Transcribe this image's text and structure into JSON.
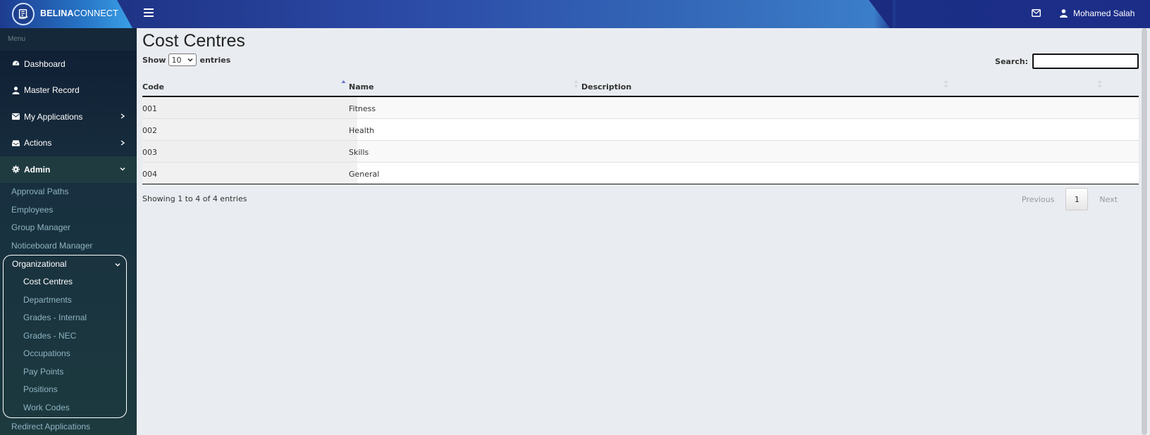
{
  "header": {
    "brand_bold": "BELINA",
    "brand_light": "CONNECT",
    "user_name": "Mohamed Salah",
    "icons": {
      "menu": "hamburger-icon",
      "mail": "envelope-icon",
      "user": "user-icon",
      "logo": "belina-logo-icon"
    }
  },
  "sidebar": {
    "menu_label": "Menu",
    "items": [
      {
        "label": "Dashboard",
        "icon": "dashboard-icon"
      },
      {
        "label": "Master Record",
        "icon": "user-icon"
      },
      {
        "label": "My Applications",
        "icon": "envelope-icon"
      },
      {
        "label": "Actions",
        "icon": "inbox-icon"
      },
      {
        "label": "Admin",
        "icon": "gear-icon"
      }
    ],
    "admin_sub": [
      "Approval Paths",
      "Employees",
      "Group Manager",
      "Noticeboard Manager"
    ],
    "org_label": "Organizational",
    "org_sub": [
      "Cost Centres",
      "Departments",
      "Grades - Internal",
      "Grades - NEC",
      "Occupations",
      "Pay Points",
      "Positions",
      "Work Codes"
    ],
    "after": "Redirect Applications"
  },
  "main": {
    "title": "Cost Centres",
    "show_label": "Show",
    "entries_label": "entries",
    "page_length": "10",
    "search_label": "Search:",
    "search_value": "",
    "columns": [
      "Code",
      "Name",
      "Description",
      ""
    ],
    "rows": [
      [
        "001",
        "Fitness",
        "",
        ""
      ],
      [
        "002",
        "Health",
        "",
        ""
      ],
      [
        "003",
        "Skills",
        "",
        ""
      ],
      [
        "004",
        "General",
        "",
        ""
      ]
    ],
    "info": "Showing 1 to 4 of 4 entries",
    "pager": {
      "previous": "Previous",
      "page": "1",
      "next": "Next"
    }
  },
  "colors": {
    "sidebar": "#18303f",
    "header_start": "#1a2a78",
    "header_end": "#3b7ec9",
    "content_bg": "#e9ecf1"
  }
}
